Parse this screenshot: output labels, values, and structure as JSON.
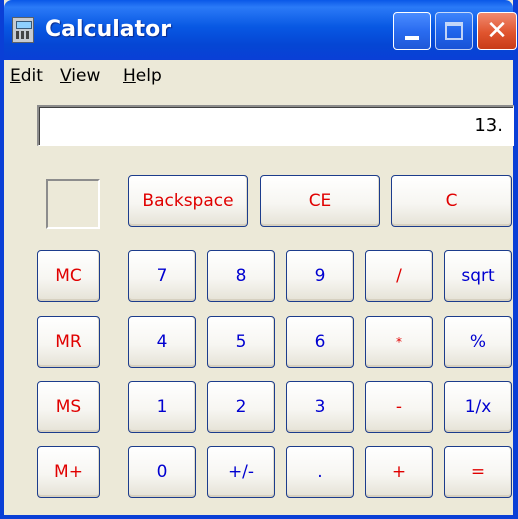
{
  "window": {
    "title": "Calculator"
  },
  "menu": [
    "Edit",
    "View",
    "Help"
  ],
  "display": {
    "value": "13."
  },
  "buttons": {
    "backspace": "Backspace",
    "ce": "CE",
    "c": "C",
    "mc": "MC",
    "mr": "MR",
    "ms": "MS",
    "mplus": "M+",
    "d7": "7",
    "d8": "8",
    "d9": "9",
    "div": "/",
    "sqrt": "sqrt",
    "d4": "4",
    "d5": "5",
    "d6": "6",
    "mul": "*",
    "pct": "%",
    "d1": "1",
    "d2": "2",
    "d3": "3",
    "sub": "-",
    "recip": "1/x",
    "d0": "0",
    "sign": "+/-",
    "dot": ".",
    "add": "+",
    "eq": "="
  },
  "colors": {
    "title_bar": "#0a58e8",
    "control_keys": "#e00000",
    "digit_keys": "#0000d0",
    "close_button": "#e0542e"
  },
  "icons": {
    "app": "calculator-icon",
    "minimize": "minimize-icon",
    "maximize": "maximize-icon",
    "close": "close-icon"
  }
}
